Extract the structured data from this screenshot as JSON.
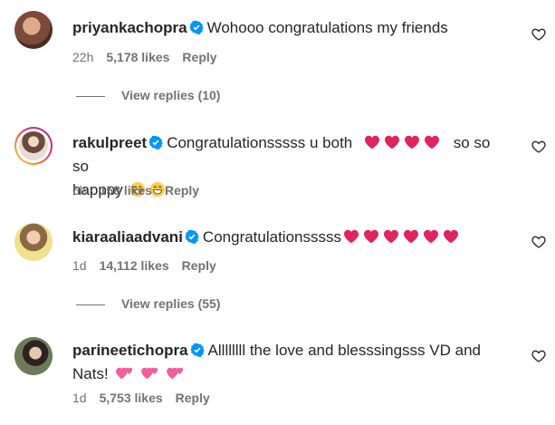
{
  "comments": [
    {
      "username": "priyankachopra",
      "text": "Wohooo congratulations my friends",
      "time": "22h",
      "likes": "5,178 likes",
      "reply": "Reply",
      "view_replies": "View replies (10)",
      "avatar_colors": [
        "#7b4a3a",
        "#c9826a"
      ]
    },
    {
      "username": "rakulpreet",
      "text": "Congratulationsssss u both",
      "text2": "so so so",
      "text3": "happpy",
      "time": "6h",
      "likes": "158 likes",
      "reply": "Reply",
      "avatar_colors": [
        "#d9c7b8",
        "#8c6e5a"
      ]
    },
    {
      "username": "kiaraaliaadvani",
      "text": "Congratulationsssss",
      "time": "1d",
      "likes": "14,112 likes",
      "reply": "Reply",
      "view_replies": "View replies (55)",
      "avatar_colors": [
        "#f1e08c",
        "#c9a24c"
      ]
    },
    {
      "username": "parineetichopra",
      "text": "Allllllll the love and blesssingsss VD and",
      "text2": "Nats!",
      "time": "1d",
      "likes": "5,753 likes",
      "reply": "Reply",
      "avatar_colors": [
        "#3d4a35",
        "#a7a388"
      ]
    }
  ],
  "colors": {
    "verified": "#0095f6",
    "heart_emoji": "#e0245e",
    "muted": "#737373",
    "text": "#262626"
  }
}
